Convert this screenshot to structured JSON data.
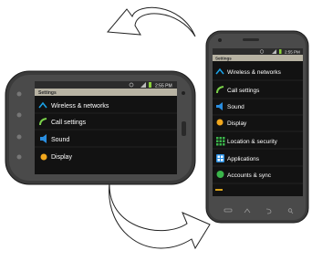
{
  "status_time": "2:55 PM",
  "settings_title": "Settings",
  "landscape_items": [
    {
      "label": "Wireless & networks",
      "icon": "wifi-icon"
    },
    {
      "label": "Call settings",
      "icon": "phone-handset-icon"
    },
    {
      "label": "Sound",
      "icon": "speaker-icon"
    },
    {
      "label": "Display",
      "icon": "brightness-icon"
    }
  ],
  "portrait_items": [
    {
      "label": "Wireless & networks",
      "icon": "wifi-icon"
    },
    {
      "label": "Call settings",
      "icon": "phone-handset-icon"
    },
    {
      "label": "Sound",
      "icon": "speaker-icon"
    },
    {
      "label": "Display",
      "icon": "brightness-icon"
    },
    {
      "label": "Location & security",
      "icon": "location-grid-icon"
    },
    {
      "label": "Applications",
      "icon": "applications-icon"
    },
    {
      "label": "Accounts & sync",
      "icon": "sync-icon"
    }
  ],
  "colors": {
    "screen": "#121212",
    "title_bar": "#b8b3a3",
    "status_bar": "#2c2c2c",
    "phone_body": "#3b3b3b",
    "arrow_stroke": "#222222"
  }
}
